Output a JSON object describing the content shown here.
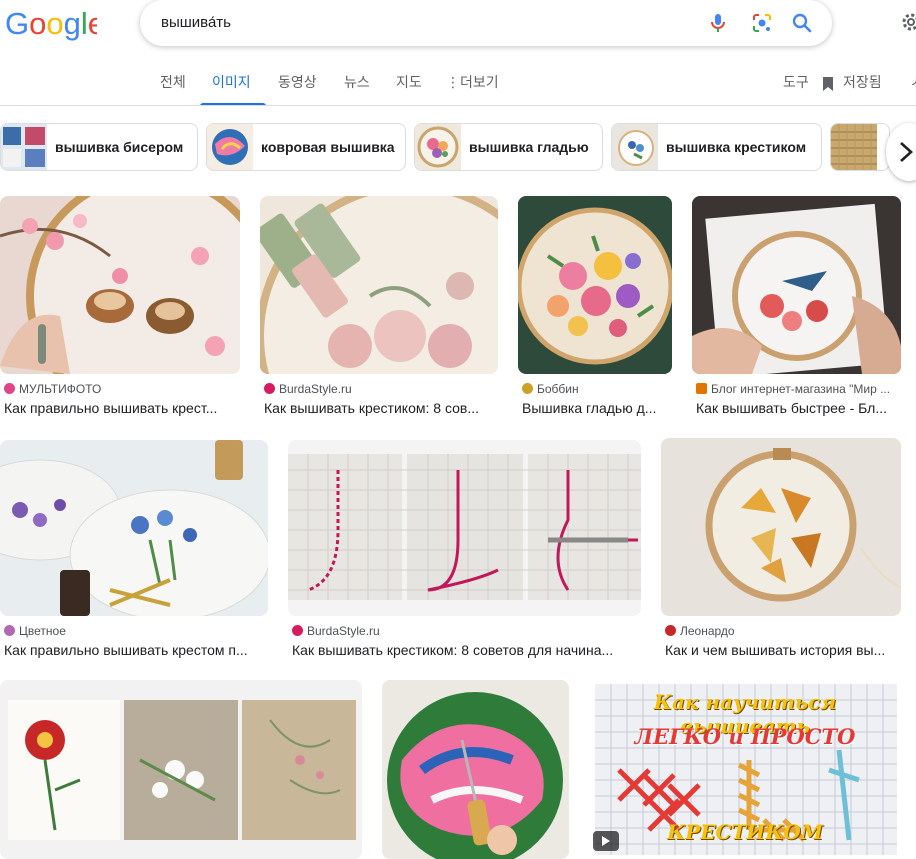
{
  "search": {
    "query": "вышива́ть"
  },
  "tabs": [
    {
      "label": "전체"
    },
    {
      "label": "이미지"
    },
    {
      "label": "동영상"
    },
    {
      "label": "뉴스"
    },
    {
      "label": "지도"
    },
    {
      "label": "더보기"
    }
  ],
  "toolbar": {
    "tools_label": "도구",
    "saved_label": "저장됨"
  },
  "chips": [
    {
      "label": "вышивка бисером"
    },
    {
      "label": "ковровая вышивка"
    },
    {
      "label": "вышивка гладью"
    },
    {
      "label": "вышивка крестиком"
    }
  ],
  "results": [
    {
      "source": "МУЛЬТИФОТО",
      "title": "Как правильно вышивать крест...",
      "favicon_color": "#e0448b"
    },
    {
      "source": "BurdaStyle.ru",
      "title": "Как вышивать крестиком: 8 сов...",
      "favicon_color": "#d81b60"
    },
    {
      "source": "Боббин",
      "title": "Вышивка гладью д...",
      "favicon_color": "#c9a227"
    },
    {
      "source": "Блог интернет-магазина \"Мир ...",
      "title": "Как вышивать быстрее - Бл...",
      "favicon_color": "#e37400"
    },
    {
      "source": "Цветное",
      "title": "Как правильно вышивать крестом п...",
      "favicon_color": "#b06ab3"
    },
    {
      "source": "BurdaStyle.ru",
      "title": "Как вышивать крестиком: 8 советов для начина...",
      "favicon_color": "#d81b60"
    },
    {
      "source": "Леонардо",
      "title": "Как и чем вышивать история вы...",
      "favicon_color": "#c62828"
    }
  ],
  "video_thumb": {
    "line1": "Как научиться вышивать",
    "line2": "ЛЕГКО и ПРОСТО",
    "line3": "КРЕСТИКОМ"
  },
  "colors": {
    "accent": "#1a73e8",
    "text": "#202124",
    "secondary": "#5f6368",
    "border": "#dadce0"
  }
}
